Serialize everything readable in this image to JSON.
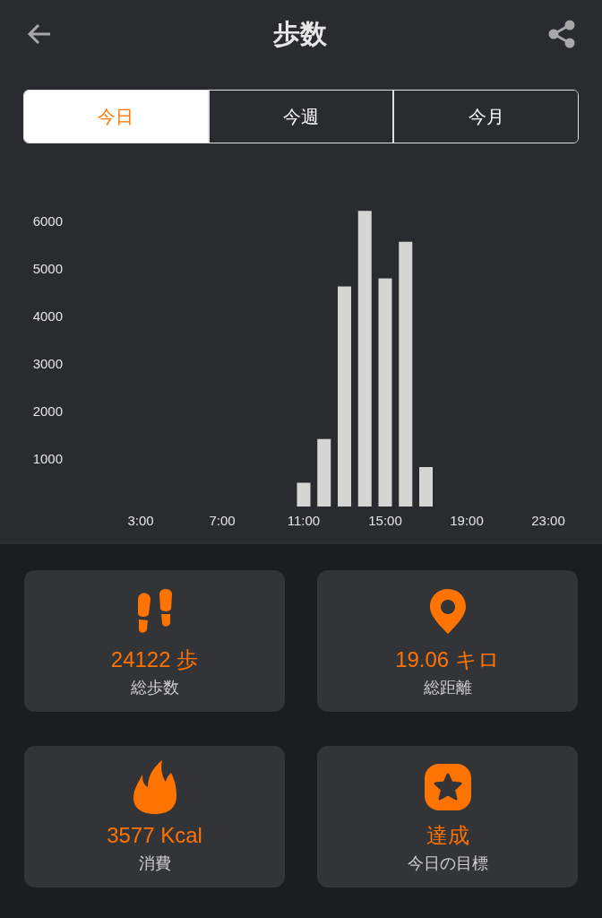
{
  "header": {
    "title": "歩数"
  },
  "tabs": [
    {
      "label": "今日",
      "selected": true
    },
    {
      "label": "今週",
      "selected": false
    },
    {
      "label": "今月",
      "selected": false
    }
  ],
  "chart": {
    "chart_data": {
      "type": "bar",
      "x": [
        11,
        12,
        13,
        14,
        15,
        16,
        17
      ],
      "series": [
        {
          "color": "#d5d6d4",
          "values": [
            500,
            1420,
            4630,
            6220,
            4800,
            5570,
            830
          ]
        }
      ],
      "xlim": [
        3,
        23
      ],
      "ylim": [
        0,
        6300
      ],
      "xticks": [
        {
          "value": 3,
          "label": "3:00"
        },
        {
          "value": 7,
          "label": "7:00"
        },
        {
          "value": 11,
          "label": "11:00"
        },
        {
          "value": 15,
          "label": "15:00"
        },
        {
          "value": 19,
          "label": "19:00"
        },
        {
          "value": 23,
          "label": "23:00"
        }
      ],
      "yticks": [
        {
          "value": 1000,
          "label": "1000"
        },
        {
          "value": 2000,
          "label": "2000"
        },
        {
          "value": 3000,
          "label": "3000"
        },
        {
          "value": 4000,
          "label": "4000"
        },
        {
          "value": 5000,
          "label": "5000"
        },
        {
          "value": 6000,
          "label": "6000"
        }
      ]
    }
  },
  "cards": [
    {
      "kind": "steps",
      "value": "24122 歩",
      "label": "総歩数"
    },
    {
      "kind": "distance",
      "value": "19.06 キロ",
      "label": "総距離"
    },
    {
      "kind": "calories",
      "value": "3577 Kcal",
      "label": "消費"
    },
    {
      "kind": "goal",
      "value": "達成",
      "label": "今日の目標"
    }
  ]
}
